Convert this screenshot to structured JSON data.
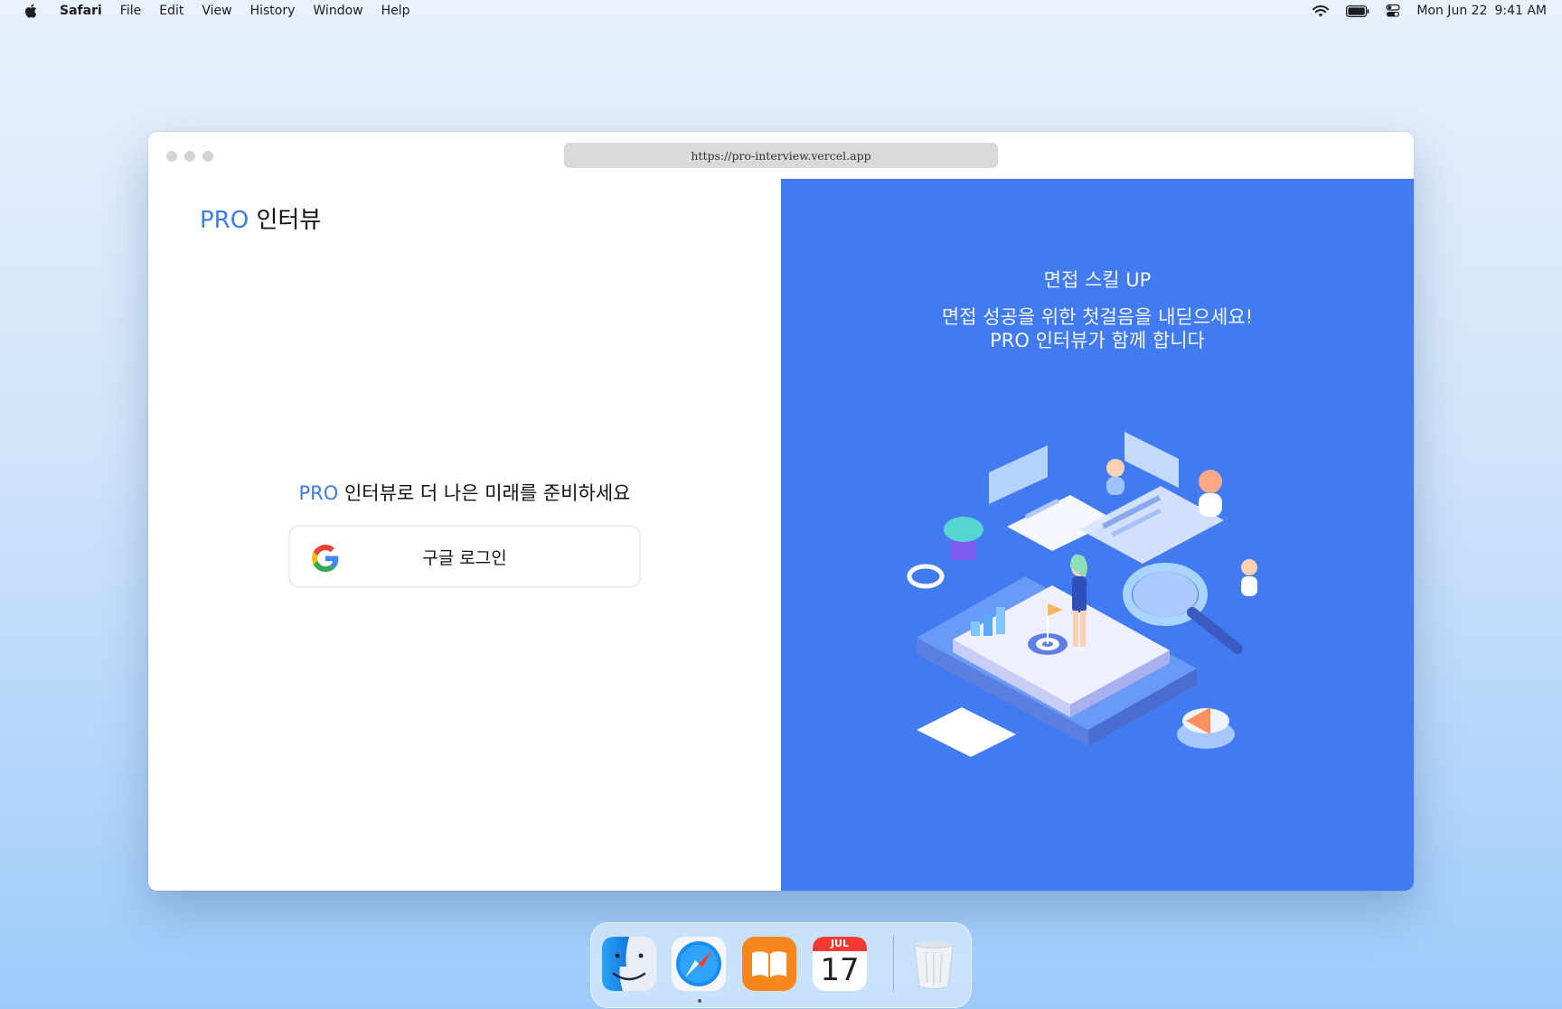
{
  "menubar": {
    "app_name": "Safari",
    "items": [
      "File",
      "Edit",
      "View",
      "History",
      "Window",
      "Help"
    ],
    "date": "Mon Jun 22",
    "time": "9:41 AM",
    "icons": [
      "apple-icon",
      "wifi-icon",
      "battery-icon",
      "control-center-icon"
    ]
  },
  "browser": {
    "url": "https://pro-interview.vercel.app"
  },
  "left": {
    "logo_pro": "PRO",
    "logo_name": "인터뷰",
    "tagline_pro": "PRO",
    "tagline_rest": " 인터뷰로 더 나은 미래를 준비하세요",
    "login_label": "구글 로그인"
  },
  "right": {
    "title": "면접 스킬 UP",
    "subtitle_line1": "면접 성공을 위한 첫걸음을 내딛으세요!",
    "subtitle_line2": "PRO 인터뷰가 함께 합니다",
    "accent_color": "#427bf0"
  },
  "dock": {
    "apps": [
      "finder-icon",
      "safari-icon",
      "books-icon",
      "calendar-icon",
      "trash-icon"
    ],
    "calendar_month": "JUL",
    "calendar_day": "17"
  }
}
